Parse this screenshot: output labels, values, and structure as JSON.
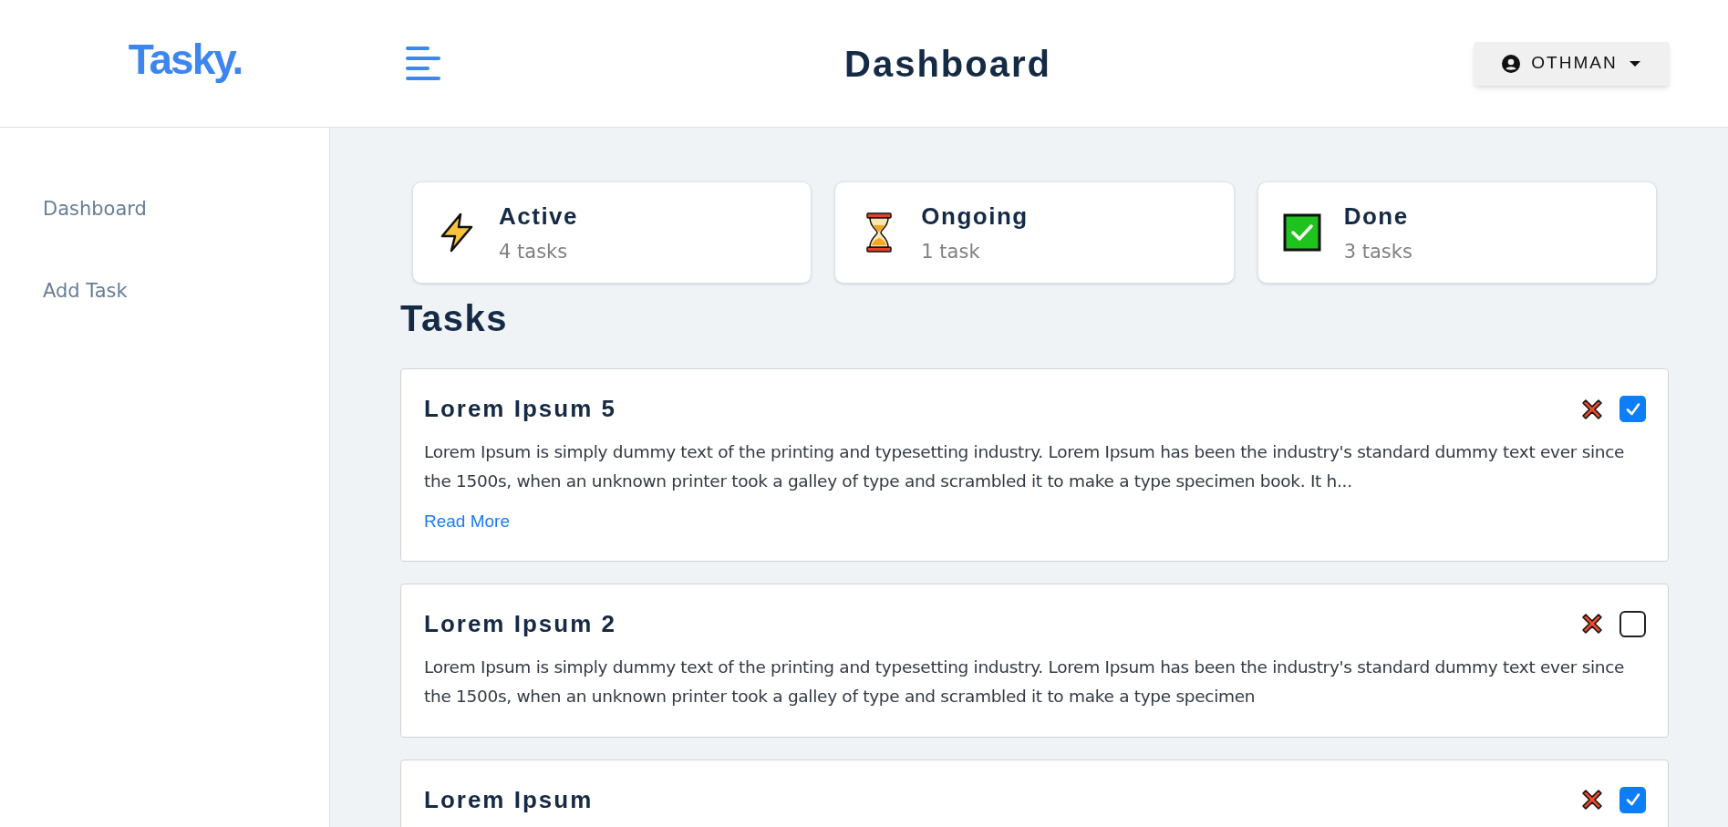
{
  "logo": "Tasky.",
  "header": {
    "title": "Dashboard",
    "user": "OTHMAN"
  },
  "sidebar": {
    "items": [
      {
        "label": "Dashboard"
      },
      {
        "label": "Add Task"
      }
    ]
  },
  "stats": [
    {
      "kind": "active",
      "label": "Active",
      "count": "4 tasks"
    },
    {
      "kind": "ongoing",
      "label": "Ongoing",
      "count": "1 task"
    },
    {
      "kind": "done",
      "label": "Done",
      "count": "3 tasks"
    }
  ],
  "tasks_title": "Tasks",
  "tasks": [
    {
      "title": "Lorem Ipsum 5",
      "checked": true,
      "description": "Lorem Ipsum is simply dummy text of the printing and typesetting industry. Lorem Ipsum has been the industry's standard dummy text ever since the 1500s, when an unknown printer took a galley of type and scrambled it to make a type specimen book. It h...",
      "link": "Read More"
    },
    {
      "title": "Lorem Ipsum 2",
      "checked": false,
      "description": "Lorem Ipsum is simply dummy text of the printing and typesetting industry. Lorem Ipsum has been the industry's standard dummy text ever since the 1500s, when an unknown printer took a galley of type and scrambled it to make a type specimen"
    },
    {
      "title": "Lorem Ipsum",
      "checked": true
    }
  ]
}
